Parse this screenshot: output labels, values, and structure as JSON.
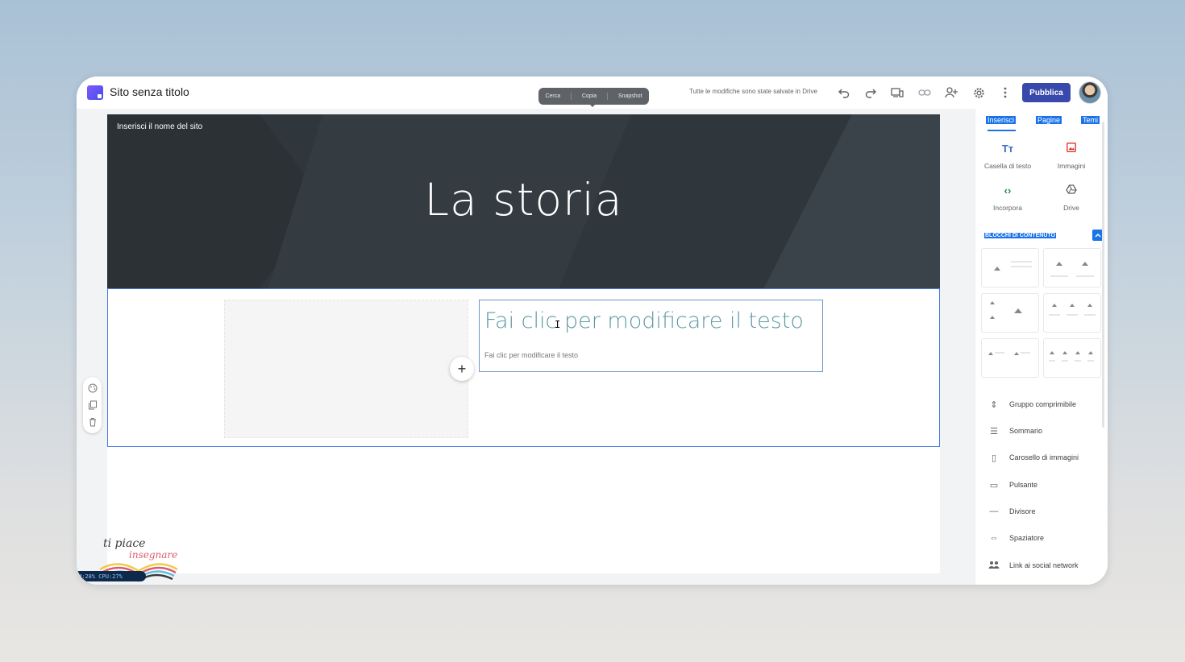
{
  "app": {
    "title": "Sito senza titolo",
    "saved_status": "Tutte le modifiche sono state salvate in Drive",
    "publish_label": "Pubblica"
  },
  "toolbar_pill": {
    "items": [
      "Cerca",
      "Copia",
      "Snapshot"
    ]
  },
  "toolbar_icons": [
    "undo-icon",
    "redo-icon",
    "preview-icon",
    "link-icon",
    "share-icon",
    "gear-icon",
    "more-icon"
  ],
  "page": {
    "site_name_placeholder": "Inserisci il nome del sito",
    "hero_title": "La storia",
    "text_heading": "Fai clic per modificare il testo",
    "text_body": "Fai clic per modificare il testo",
    "add_symbol": "+"
  },
  "logo": {
    "line1": "ti piace",
    "line2": "insegnare"
  },
  "status_bar": {
    "text": "M:28%  CPU:27%"
  },
  "sidebar": {
    "tabs": [
      "Inserisci",
      "Pagine",
      "Temi"
    ],
    "insert_items": [
      {
        "label": "Casella di testo",
        "icon": "text-box-icon",
        "glyph": "Tт",
        "color": "#3c6ec4"
      },
      {
        "label": "Immagini",
        "icon": "image-icon",
        "glyph": "▣",
        "color": "#d93025"
      },
      {
        "label": "Incorpora",
        "icon": "embed-icon",
        "glyph": "‹›",
        "color": "#1e8e3e"
      },
      {
        "label": "Drive",
        "icon": "drive-icon",
        "glyph": "△",
        "color": "#5f6368"
      }
    ],
    "blocks_label": "BLOCCHI DI CONTENUTO",
    "components": [
      {
        "label": "Gruppo comprimibile",
        "icon": "collapsible-icon",
        "glyph": "⇕"
      },
      {
        "label": "Sommario",
        "icon": "toc-icon",
        "glyph": "☰"
      },
      {
        "label": "Carosello di immagini",
        "icon": "carousel-icon",
        "glyph": "▯"
      },
      {
        "label": "Pulsante",
        "icon": "button-icon",
        "glyph": "▭"
      },
      {
        "label": "Divisore",
        "icon": "divider-icon",
        "glyph": "—"
      },
      {
        "label": "Spaziatore",
        "icon": "spacer-icon",
        "glyph": "⇔"
      },
      {
        "label": "Link ai social network",
        "icon": "social-icon",
        "glyph": "👥"
      }
    ]
  },
  "colors": {
    "accent": "#1a73e8",
    "publish": "#3949ab",
    "hero_bg": "#30373c",
    "heading_text": "#5d9aa3"
  }
}
